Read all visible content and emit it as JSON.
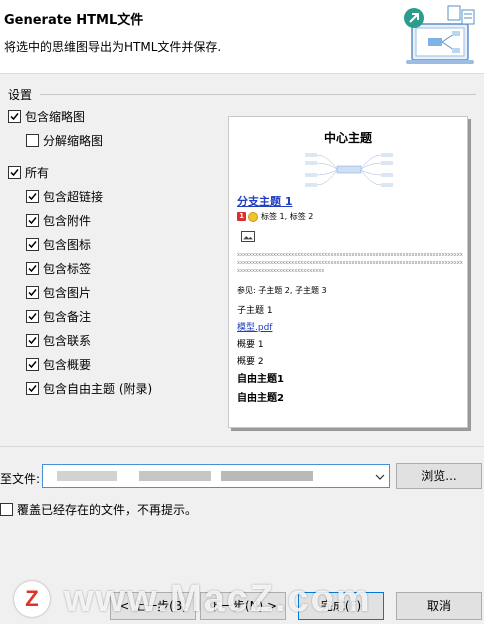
{
  "header": {
    "title": "Generate HTML文件",
    "subtitle": "将选中的思维图导出为HTML文件并保存."
  },
  "settings": {
    "group_label": "设置",
    "options": [
      {
        "label": "包含缩略图",
        "checked": true
      },
      {
        "label": "分解缩略图",
        "checked": false
      },
      {
        "label": "所有",
        "checked": true
      },
      {
        "label": "包含超链接",
        "checked": true
      },
      {
        "label": "包含附件",
        "checked": true
      },
      {
        "label": "包含图标",
        "checked": true
      },
      {
        "label": "包含标签",
        "checked": true
      },
      {
        "label": "包含图片",
        "checked": true
      },
      {
        "label": "包含备注",
        "checked": true
      },
      {
        "label": "包含联系",
        "checked": true
      },
      {
        "label": "包含概要",
        "checked": true
      },
      {
        "label": "包含自由主题 (附录)",
        "checked": true
      }
    ]
  },
  "preview": {
    "title": "中心主题",
    "branch": "分支主题 1",
    "badge": "1",
    "tags": "标签 1, 标签 2",
    "xline": "xxxxxxxxxxxxxxxxxxxxxxxxxxxxxxxxxxxxxxxxxxxxxxxxxxxxxxxxxxxxxxxxxxxxxxxxxxxxxxxxxxxxxxxxxxxxxxxxxxxxxxxxxxxxxxxxxxxxxxxxxxxxxxxxxxxxxxxxxxxxxxxxxxxxxxxxxxxxxxxxxxxxxxxxxxxxxxxxxxx",
    "see_also": "参见:   子主题 2, 子主题 3",
    "subtopic": "子主题 1",
    "attachment": "模型.pdf",
    "summary1": "概要 1",
    "summary2": "概要 2",
    "free1": "自由主题1",
    "free2": "自由主题2"
  },
  "file": {
    "label": "至文件:",
    "browse_label": "浏览..."
  },
  "overwrite": {
    "label": "覆盖已经存在的文件，不再提示。",
    "checked": false
  },
  "buttons": {
    "back": "< 上一步(B)",
    "next": "下一步(N) >",
    "finish": "完成(F)",
    "cancel": "取消"
  },
  "watermark": {
    "logo_letter": "Z",
    "text": "www.MacZ.com"
  },
  "colors": {
    "accent": "#0078d7",
    "link": "#1f3fbf"
  }
}
